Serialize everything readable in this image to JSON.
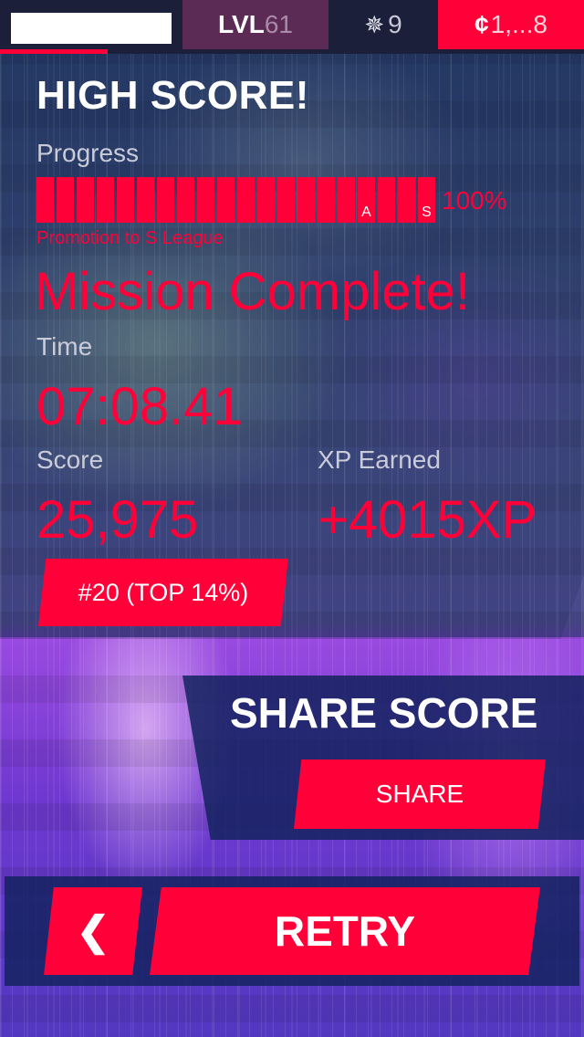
{
  "topbar": {
    "level_label": "LVL",
    "level_value": "61",
    "phoenix_icon": "phoenix-icon",
    "phoenix_count": "9",
    "coin_icon": "coin-icon",
    "coin_symbol": "¢",
    "coins": "1,...8",
    "xp_progress_fraction": 0.185
  },
  "results": {
    "headline": "HIGH SCORE!",
    "progress_label": "Progress",
    "progress_percent": "100%",
    "progress_segments": 20,
    "progress_marks": {
      "16": "A",
      "19": "S"
    },
    "promotion_text": "Promotion to S League",
    "mission_text": "Mission Complete!",
    "time_label": "Time",
    "time_value": "07:08.41",
    "score_label": "Score",
    "score_value": "25,975",
    "xp_label": "XP Earned",
    "xp_value": "+4015XP",
    "rank_label": "#20 (TOP 14%)"
  },
  "share": {
    "title": "SHARE SCORE",
    "button_label": "SHARE"
  },
  "footer": {
    "back_label": "❮",
    "retry_label": "RETRY"
  },
  "colors": {
    "accent": "#ff0038",
    "topbar": "#1b1f3a",
    "level_cell": "#5b2b55"
  }
}
